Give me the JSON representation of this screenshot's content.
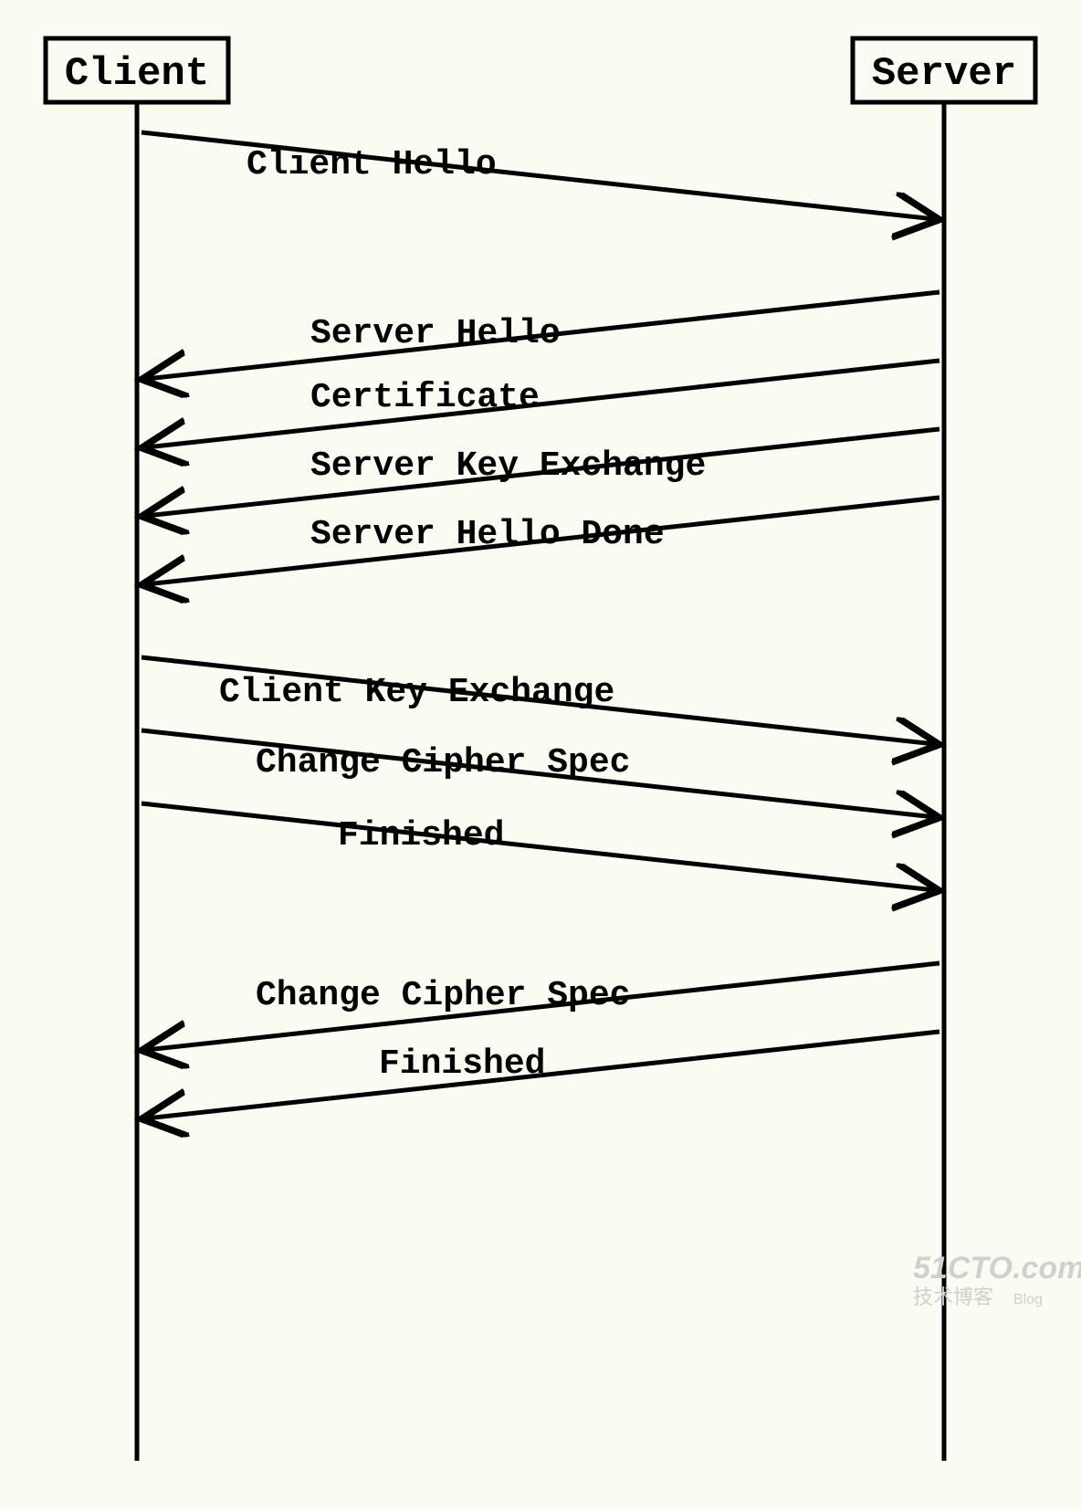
{
  "actors": {
    "left": "Client",
    "right": "Server"
  },
  "messages": {
    "m1": "Client Hello",
    "m2": "Server Hello",
    "m3": "Certificate",
    "m4": "Server Key Exchange",
    "m5": "Server Hello Done",
    "m6": "Client Key Exchange",
    "m7": "Change Cipher Spec",
    "m8": "Finished",
    "m9": "Change Cipher Spec",
    "m10": "Finished"
  },
  "watermark": {
    "line1": "51CTO.com",
    "line2": "技术博客",
    "line3": "Blog"
  }
}
